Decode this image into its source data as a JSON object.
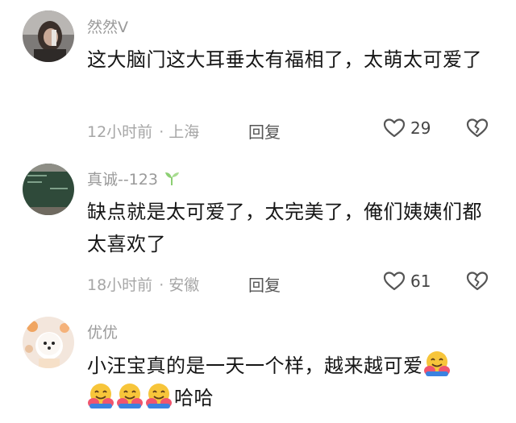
{
  "comments": [
    {
      "username": "然然V",
      "text": "这大脑门这大耳垂太有福相了，太萌太可爱了",
      "time": "12小时前",
      "location": "上海",
      "reply_label": "回复",
      "likes": "29",
      "avatar_icon": "user-photo-avatar"
    },
    {
      "username": "真诚--123",
      "text": "缺点就是太可爱了，太完美了，俺们姨姨们都太喜欢了",
      "time": "18小时前",
      "location": "安徽",
      "reply_label": "回复",
      "likes": "61",
      "avatar_icon": "chalkboard-avatar"
    },
    {
      "username": "优优",
      "text": "小汪宝真的是一天一个样，越来越可爱",
      "text_end": "哈哈",
      "avatar_icon": "puppy-avatar"
    }
  ],
  "separator": " · ",
  "colors": {
    "meta_gray": "#a6a6a6",
    "username_gray": "#9a9a9a",
    "text_black": "#161616"
  }
}
